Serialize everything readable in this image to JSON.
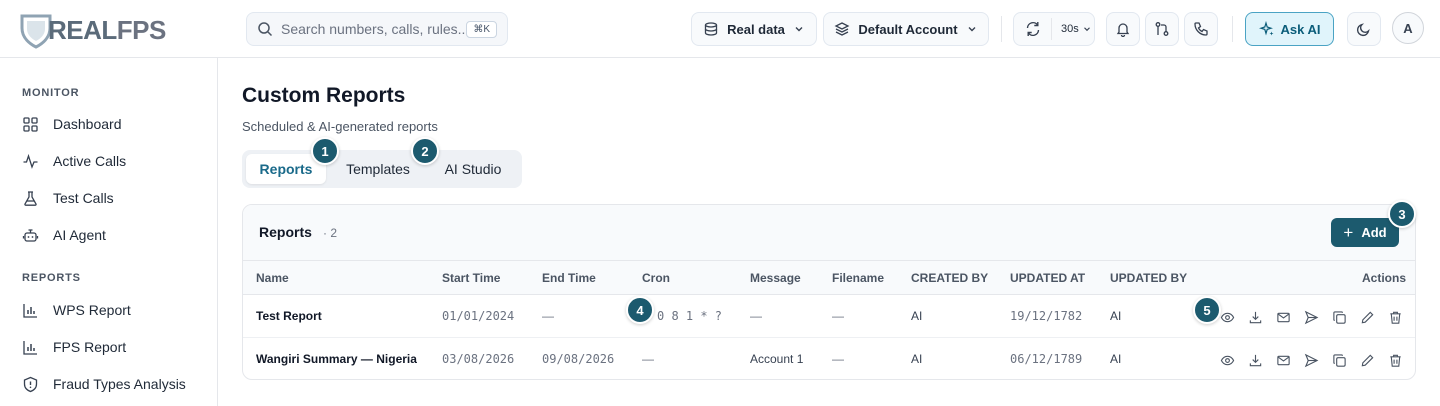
{
  "brand": {
    "name_a": "REAL",
    "name_b": "FPS"
  },
  "search": {
    "placeholder": "Search numbers, calls, rules...",
    "shortcut": "⌘K"
  },
  "header": {
    "data_source": "Real data",
    "account": "Default Account",
    "refresh_interval": "30s",
    "ask_ai": "Ask AI",
    "avatar_initial": "A"
  },
  "sidebar": {
    "sections": [
      {
        "title": "MONITOR",
        "items": [
          {
            "label": "Dashboard",
            "icon": "grid-icon"
          },
          {
            "label": "Active Calls",
            "icon": "activity-icon"
          },
          {
            "label": "Test Calls",
            "icon": "flask-icon"
          },
          {
            "label": "AI Agent",
            "icon": "bot-icon"
          }
        ]
      },
      {
        "title": "REPORTS",
        "items": [
          {
            "label": "WPS Report",
            "icon": "bar-chart-icon"
          },
          {
            "label": "FPS Report",
            "icon": "bar-chart-icon"
          },
          {
            "label": "Fraud Types Analysis",
            "icon": "shield-alert-icon"
          }
        ]
      }
    ]
  },
  "page": {
    "title": "Custom Reports",
    "subtitle": "Scheduled & AI-generated reports"
  },
  "tabs": [
    {
      "label": "Reports",
      "active": true
    },
    {
      "label": "Templates",
      "active": false
    },
    {
      "label": "AI Studio",
      "active": false
    }
  ],
  "badges": [
    "1",
    "2",
    "3",
    "4",
    "5"
  ],
  "reports": {
    "title": "Reports",
    "count": "· 2",
    "add_label": "Add",
    "columns": [
      "Name",
      "Start Time",
      "End Time",
      "Cron",
      "Message",
      "Filename",
      "CREATED BY",
      "UPDATED AT",
      "UPDATED BY",
      "Actions"
    ],
    "rows": [
      {
        "name": "Test Report",
        "start": "01/01/2024",
        "end": "—",
        "cron": "0 8 1 * ?",
        "message": "—",
        "filename": "—",
        "created_by": "AI",
        "updated_at": "19/12/1782",
        "updated_by": "AI"
      },
      {
        "name": "Wangiri Summary — Nigeria",
        "start": "03/08/2026",
        "end": "09/08/2026",
        "cron": "—",
        "message": "Account 1",
        "filename": "—",
        "created_by": "AI",
        "updated_at": "06/12/1789",
        "updated_by": "AI"
      }
    ]
  },
  "colors": {
    "accent": "#1c5a6e",
    "ask_bg": "#e0f4fb",
    "tab_active": "#1a6a8a"
  }
}
